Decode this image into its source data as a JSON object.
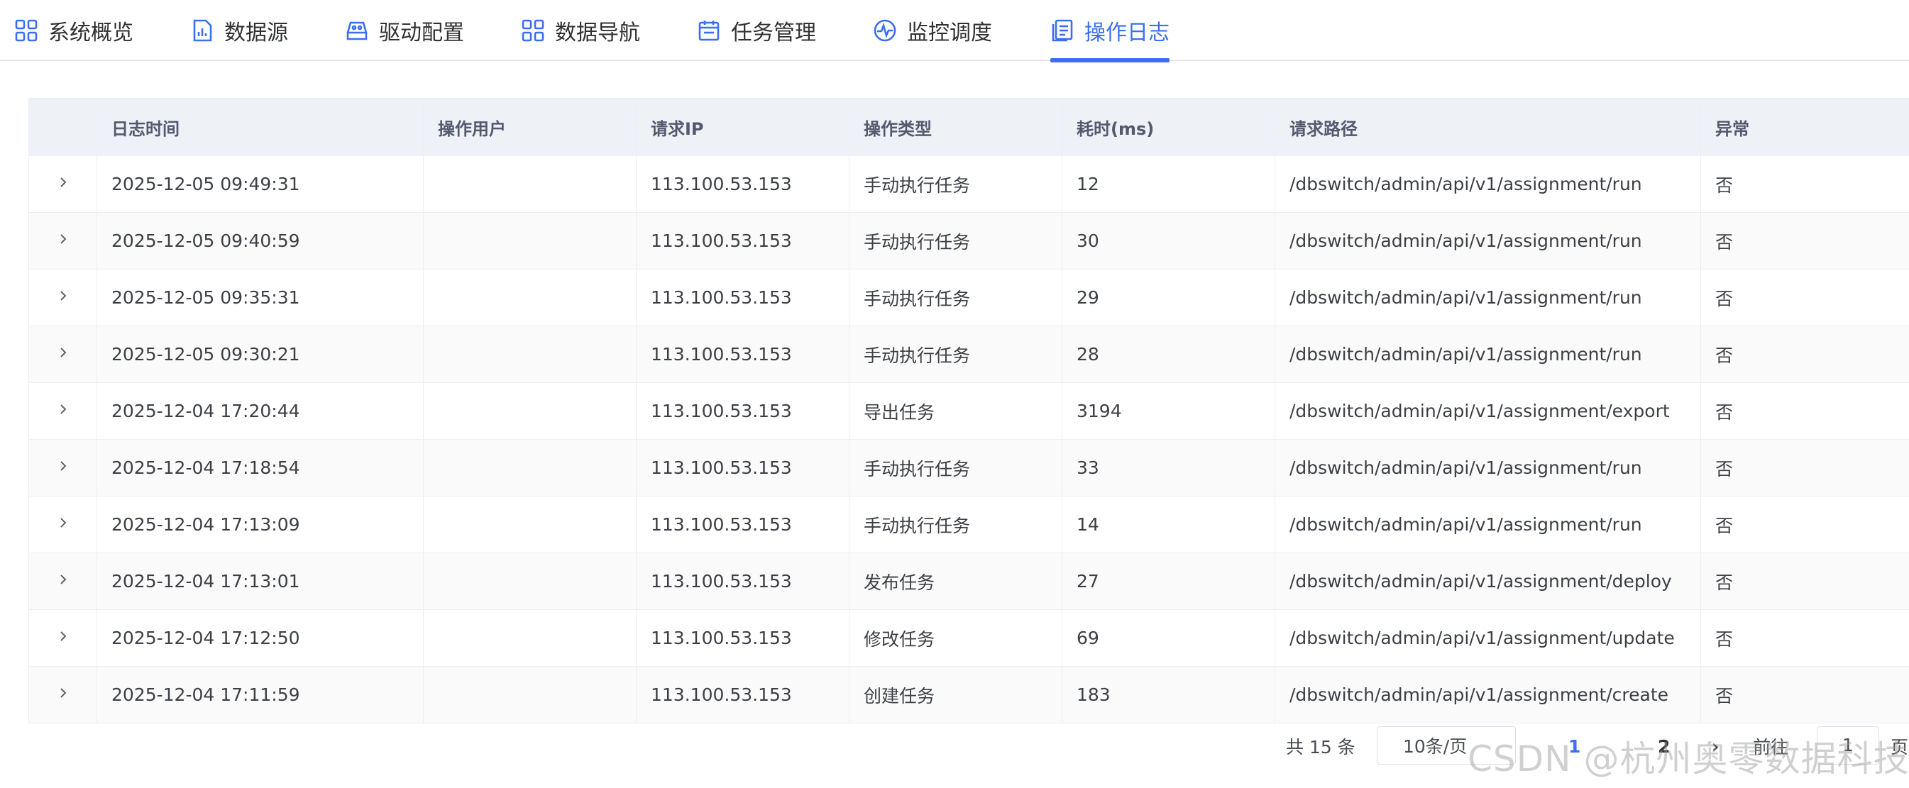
{
  "nav": {
    "items": [
      {
        "label": "系统概览",
        "icon": "grid-icon"
      },
      {
        "label": "数据源",
        "icon": "bar-chart-icon"
      },
      {
        "label": "驱动配置",
        "icon": "drive-icon"
      },
      {
        "label": "数据导航",
        "icon": "grid-icon"
      },
      {
        "label": "任务管理",
        "icon": "calendar-icon"
      },
      {
        "label": "监控调度",
        "icon": "pulse-icon"
      },
      {
        "label": "操作日志",
        "icon": "log-icon"
      }
    ],
    "active": "操作日志",
    "accent_color": "#3a6ff0"
  },
  "table": {
    "headers": [
      "日志时间",
      "操作用户",
      "请求IP",
      "操作类型",
      "耗时(ms)",
      "请求路径",
      "异常"
    ],
    "rows": [
      {
        "time": "2025-12-05 09:49:31",
        "user": "",
        "ip": "113.100.53.153",
        "type": "手动执行任务",
        "cost": "12",
        "path": "/dbswitch/admin/api/v1/assignment/run",
        "error": "否"
      },
      {
        "time": "2025-12-05 09:40:59",
        "user": "",
        "ip": "113.100.53.153",
        "type": "手动执行任务",
        "cost": "30",
        "path": "/dbswitch/admin/api/v1/assignment/run",
        "error": "否"
      },
      {
        "time": "2025-12-05 09:35:31",
        "user": "",
        "ip": "113.100.53.153",
        "type": "手动执行任务",
        "cost": "29",
        "path": "/dbswitch/admin/api/v1/assignment/run",
        "error": "否"
      },
      {
        "time": "2025-12-05 09:30:21",
        "user": "",
        "ip": "113.100.53.153",
        "type": "手动执行任务",
        "cost": "28",
        "path": "/dbswitch/admin/api/v1/assignment/run",
        "error": "否"
      },
      {
        "time": "2025-12-04 17:20:44",
        "user": "",
        "ip": "113.100.53.153",
        "type": "导出任务",
        "cost": "3194",
        "path": "/dbswitch/admin/api/v1/assignment/export",
        "error": "否"
      },
      {
        "time": "2025-12-04 17:18:54",
        "user": "",
        "ip": "113.100.53.153",
        "type": "手动执行任务",
        "cost": "33",
        "path": "/dbswitch/admin/api/v1/assignment/run",
        "error": "否"
      },
      {
        "time": "2025-12-04 17:13:09",
        "user": "",
        "ip": "113.100.53.153",
        "type": "手动执行任务",
        "cost": "14",
        "path": "/dbswitch/admin/api/v1/assignment/run",
        "error": "否"
      },
      {
        "time": "2025-12-04 17:13:01",
        "user": "",
        "ip": "113.100.53.153",
        "type": "发布任务",
        "cost": "27",
        "path": "/dbswitch/admin/api/v1/assignment/deploy",
        "error": "否"
      },
      {
        "time": "2025-12-04 17:12:50",
        "user": "",
        "ip": "113.100.53.153",
        "type": "修改任务",
        "cost": "69",
        "path": "/dbswitch/admin/api/v1/assignment/update",
        "error": "否"
      },
      {
        "time": "2025-12-04 17:11:59",
        "user": "",
        "ip": "113.100.53.153",
        "type": "创建任务",
        "cost": "183",
        "path": "/dbswitch/admin/api/v1/assignment/create",
        "error": "否"
      }
    ]
  },
  "pagination": {
    "total": "共 15 条",
    "page_size": "10条/页",
    "pages": [
      "1",
      "2"
    ],
    "current_page": "1",
    "goto_label": "前往",
    "jump_value": "1",
    "unit": "页"
  },
  "watermark": "CSDN @杭州奥零数据科技"
}
